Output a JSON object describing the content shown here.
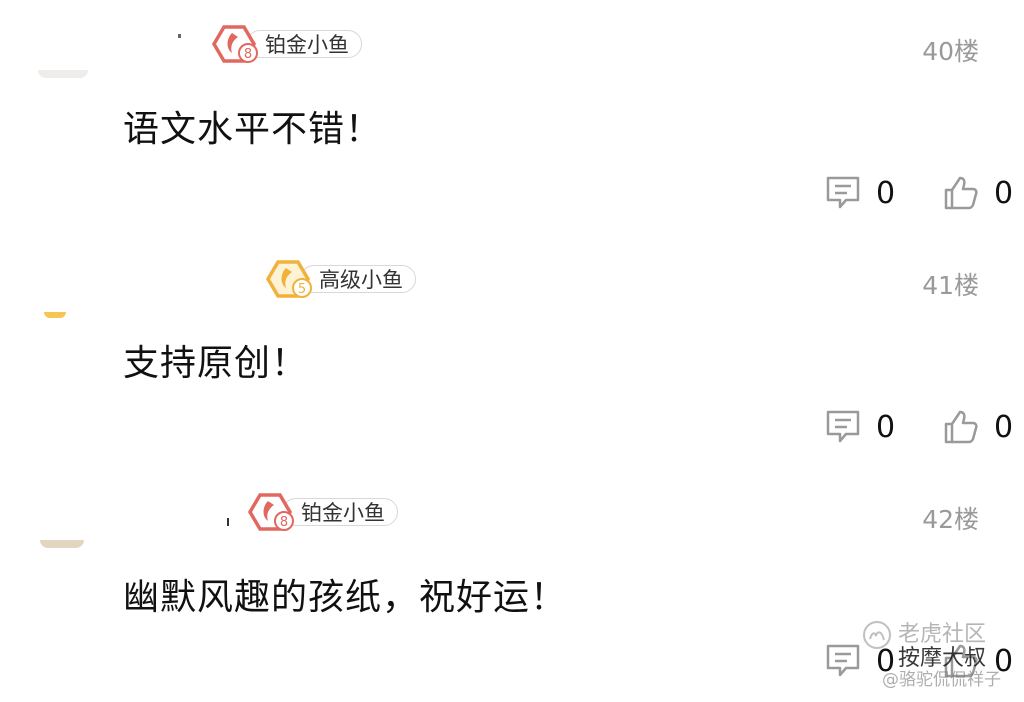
{
  "colors": {
    "platinum_badge": "#e2685f",
    "senior_badge": "#f0b23b",
    "floor_text": "#999999",
    "icon_gray": "#9a9a9a"
  },
  "comments": [
    {
      "badge": {
        "label": "铂金小鱼",
        "level": "8",
        "tier": "platinum",
        "icon": "fish-hexagon-icon"
      },
      "floor": "40楼",
      "text": "语文水平不错！",
      "reply_count": "0",
      "like_count": "0"
    },
    {
      "badge": {
        "label": "高级小鱼",
        "level": "5",
        "tier": "senior",
        "icon": "fish-hexagon-icon"
      },
      "floor": "41楼",
      "text": "支持原创！",
      "reply_count": "0",
      "like_count": "0"
    },
    {
      "badge": {
        "label": "铂金小鱼",
        "level": "8",
        "tier": "platinum",
        "icon": "fish-hexagon-icon"
      },
      "floor": "42楼",
      "text": "幽默风趣的孩纸，祝好运！",
      "reply_count": "0",
      "like_count": "0"
    }
  ],
  "watermark": {
    "line1": "老虎社区",
    "line2": "按摩大叔",
    "line3": "@骆驼侃侃祥子",
    "icon": "camel-logo-icon"
  }
}
